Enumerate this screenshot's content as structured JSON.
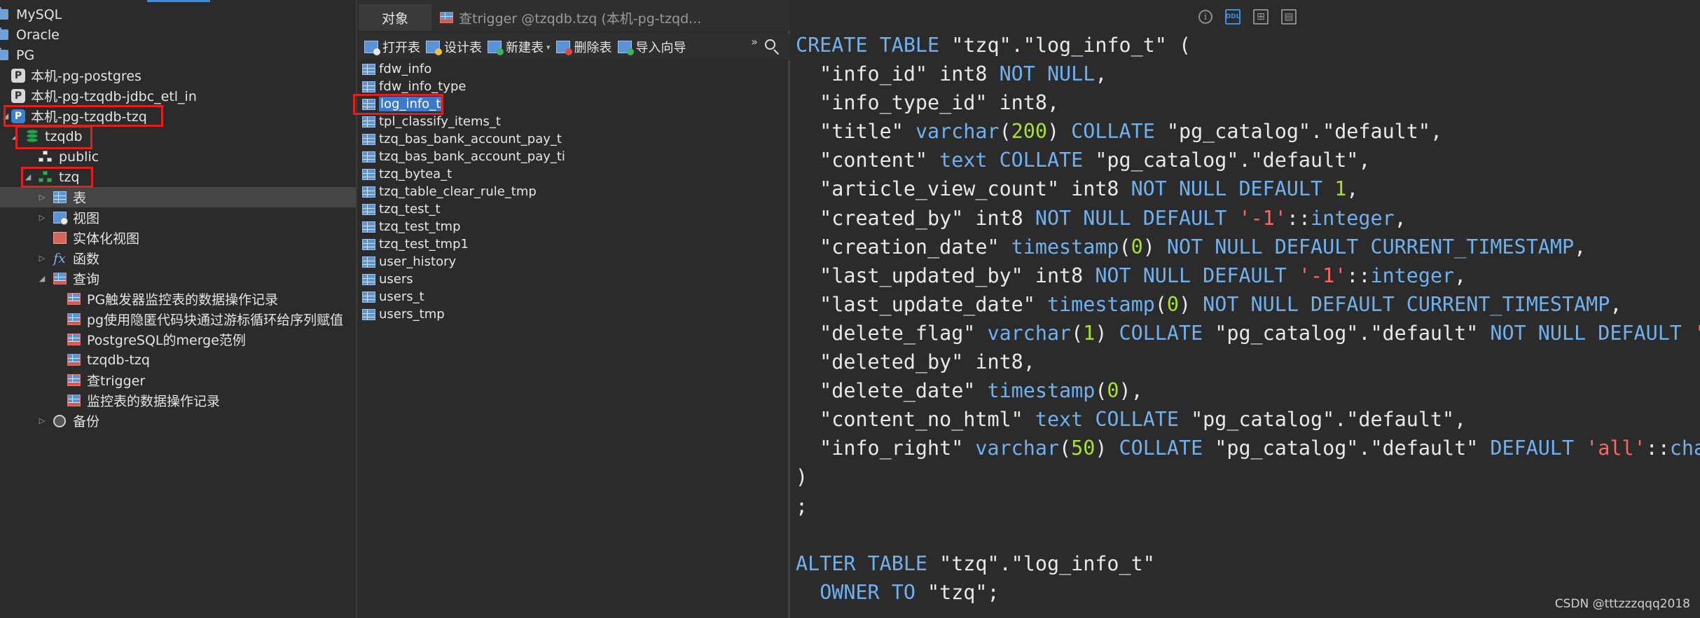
{
  "tree": {
    "items": [
      {
        "label": "MySQL",
        "icon": "folder-icon"
      },
      {
        "label": "Oracle",
        "icon": "folder-icon"
      },
      {
        "label": "PG",
        "icon": "folder-icon"
      },
      {
        "label": "本机-pg-postgres",
        "icon": "postgres-connection-icon"
      },
      {
        "label": "本机-pg-tzqdb-jdbc_etl_in",
        "icon": "postgres-connection-icon"
      },
      {
        "label": "本机-pg-tzqdb-tzq",
        "icon": "postgres-connection-icon"
      },
      {
        "label": "tzqdb",
        "icon": "database-icon"
      },
      {
        "label": "public",
        "icon": "schema-icon"
      },
      {
        "label": "tzq",
        "icon": "schema-icon"
      },
      {
        "label": "表",
        "icon": "table-icon"
      },
      {
        "label": "视图",
        "icon": "view-icon"
      },
      {
        "label": "实体化视图",
        "icon": "materialized-view-icon"
      },
      {
        "label": "函数",
        "icon": "function-icon"
      },
      {
        "label": "查询",
        "icon": "query-icon"
      },
      {
        "label": "PG触发器监控表的数据操作记录",
        "icon": "query-item-icon"
      },
      {
        "label": "pg使用隐匿代码块通过游标循环给序列赋值",
        "icon": "query-item-icon"
      },
      {
        "label": "PostgreSQL的merge范例",
        "icon": "query-item-icon"
      },
      {
        "label": "tzqdb-tzq",
        "icon": "query-item-icon"
      },
      {
        "label": "查trigger",
        "icon": "query-item-icon"
      },
      {
        "label": "监控表的数据操作记录",
        "icon": "query-item-icon"
      },
      {
        "label": "备份",
        "icon": "backup-icon"
      }
    ]
  },
  "tabs": {
    "objects": "对象",
    "query_tab": "查trigger @tzqdb.tzq (本机-pg-tzqd..."
  },
  "toolbar": {
    "open": "打开表",
    "design": "设计表",
    "new": "新建表",
    "delete": "删除表",
    "import": "导入向导",
    "more": "»"
  },
  "tables": [
    "fdw_info",
    "fdw_info_type",
    "log_info_t",
    "tpl_classify_items_t",
    "tzq_bas_bank_account_pay_t",
    "tzq_bas_bank_account_pay_ti",
    "tzq_bytea_t",
    "tzq_table_clear_rule_tmp",
    "tzq_test_t",
    "tzq_test_tmp",
    "tzq_test_tmp1",
    "user_history",
    "users",
    "users_t",
    "users_tmp"
  ],
  "selected_table": "log_info_t",
  "ddl_tools": {
    "info": "i",
    "ddl": "DDL"
  },
  "watermark": "CSDN @tttzzzqqq2018",
  "colors": {
    "background": "#2b2b2b",
    "keyword": "#6fb1ef",
    "number": "#a6e22e",
    "string": "#ff6464",
    "selection": "#3d78cf",
    "highlight_box": "#e21f1f"
  }
}
